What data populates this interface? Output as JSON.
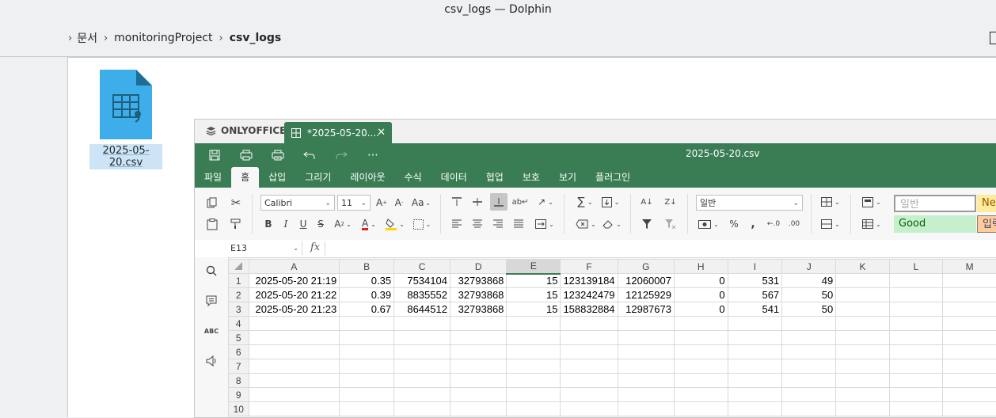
{
  "window": {
    "title": "csv_logs — Dolphin"
  },
  "breadcrumb": {
    "items": [
      "문서",
      "monitoringProject",
      "csv_logs"
    ]
  },
  "file": {
    "name": "2025-05-20.csv",
    "icon": "spreadsheet-file-icon",
    "icon_color": "#3daee9"
  },
  "onlyoffice": {
    "brand": "ONLYOFFICE",
    "tab_label": "*2025-05-20....",
    "doc_title": "2025-05-20.csv",
    "accent": "#3a7d54",
    "menu": [
      "파일",
      "홈",
      "삽입",
      "그리기",
      "레이아웃",
      "수식",
      "데이터",
      "협업",
      "보호",
      "보기",
      "플러그인"
    ],
    "active_menu": "홈",
    "ribbon": {
      "font_name": "Calibri",
      "font_size": "11",
      "number_format": "일반",
      "style_normal": "일반",
      "style_good": "Good",
      "style_neutral": "Neu",
      "style_input": "입력"
    },
    "formula_bar": {
      "cell_ref": "E13",
      "fx": "fx",
      "value": ""
    },
    "sheet": {
      "columns": [
        "A",
        "B",
        "C",
        "D",
        "E",
        "F",
        "G",
        "H",
        "I",
        "J",
        "K",
        "L",
        "M"
      ],
      "selected_column": "E",
      "rows": [
        {
          "n": "1",
          "cells": [
            "2025-05-20 21:19",
            "0.35",
            "7534104",
            "32793868",
            "15",
            "123139184",
            "12060007",
            "0",
            "531",
            "49",
            "",
            "",
            ""
          ]
        },
        {
          "n": "2",
          "cells": [
            "2025-05-20 21:22",
            "0.39",
            "8835552",
            "32793868",
            "15",
            "123242479",
            "12125929",
            "0",
            "567",
            "50",
            "",
            "",
            ""
          ]
        },
        {
          "n": "3",
          "cells": [
            "2025-05-20 21:23",
            "0.67",
            "8644512",
            "32793868",
            "15",
            "158832884",
            "12987673",
            "0",
            "541",
            "50",
            "",
            "",
            ""
          ]
        },
        {
          "n": "4",
          "cells": [
            "",
            "",
            "",
            "",
            "",
            "",
            "",
            "",
            "",
            "",
            "",
            "",
            ""
          ]
        },
        {
          "n": "5",
          "cells": [
            "",
            "",
            "",
            "",
            "",
            "",
            "",
            "",
            "",
            "",
            "",
            "",
            ""
          ]
        },
        {
          "n": "6",
          "cells": [
            "",
            "",
            "",
            "",
            "",
            "",
            "",
            "",
            "",
            "",
            "",
            "",
            ""
          ]
        },
        {
          "n": "7",
          "cells": [
            "",
            "",
            "",
            "",
            "",
            "",
            "",
            "",
            "",
            "",
            "",
            "",
            ""
          ]
        },
        {
          "n": "8",
          "cells": [
            "",
            "",
            "",
            "",
            "",
            "",
            "",
            "",
            "",
            "",
            "",
            "",
            ""
          ]
        },
        {
          "n": "9",
          "cells": [
            "",
            "",
            "",
            "",
            "",
            "",
            "",
            "",
            "",
            "",
            "",
            "",
            ""
          ]
        },
        {
          "n": "10",
          "cells": [
            "",
            "",
            "",
            "",
            "",
            "",
            "",
            "",
            "",
            "",
            "",
            "",
            ""
          ]
        }
      ]
    }
  }
}
